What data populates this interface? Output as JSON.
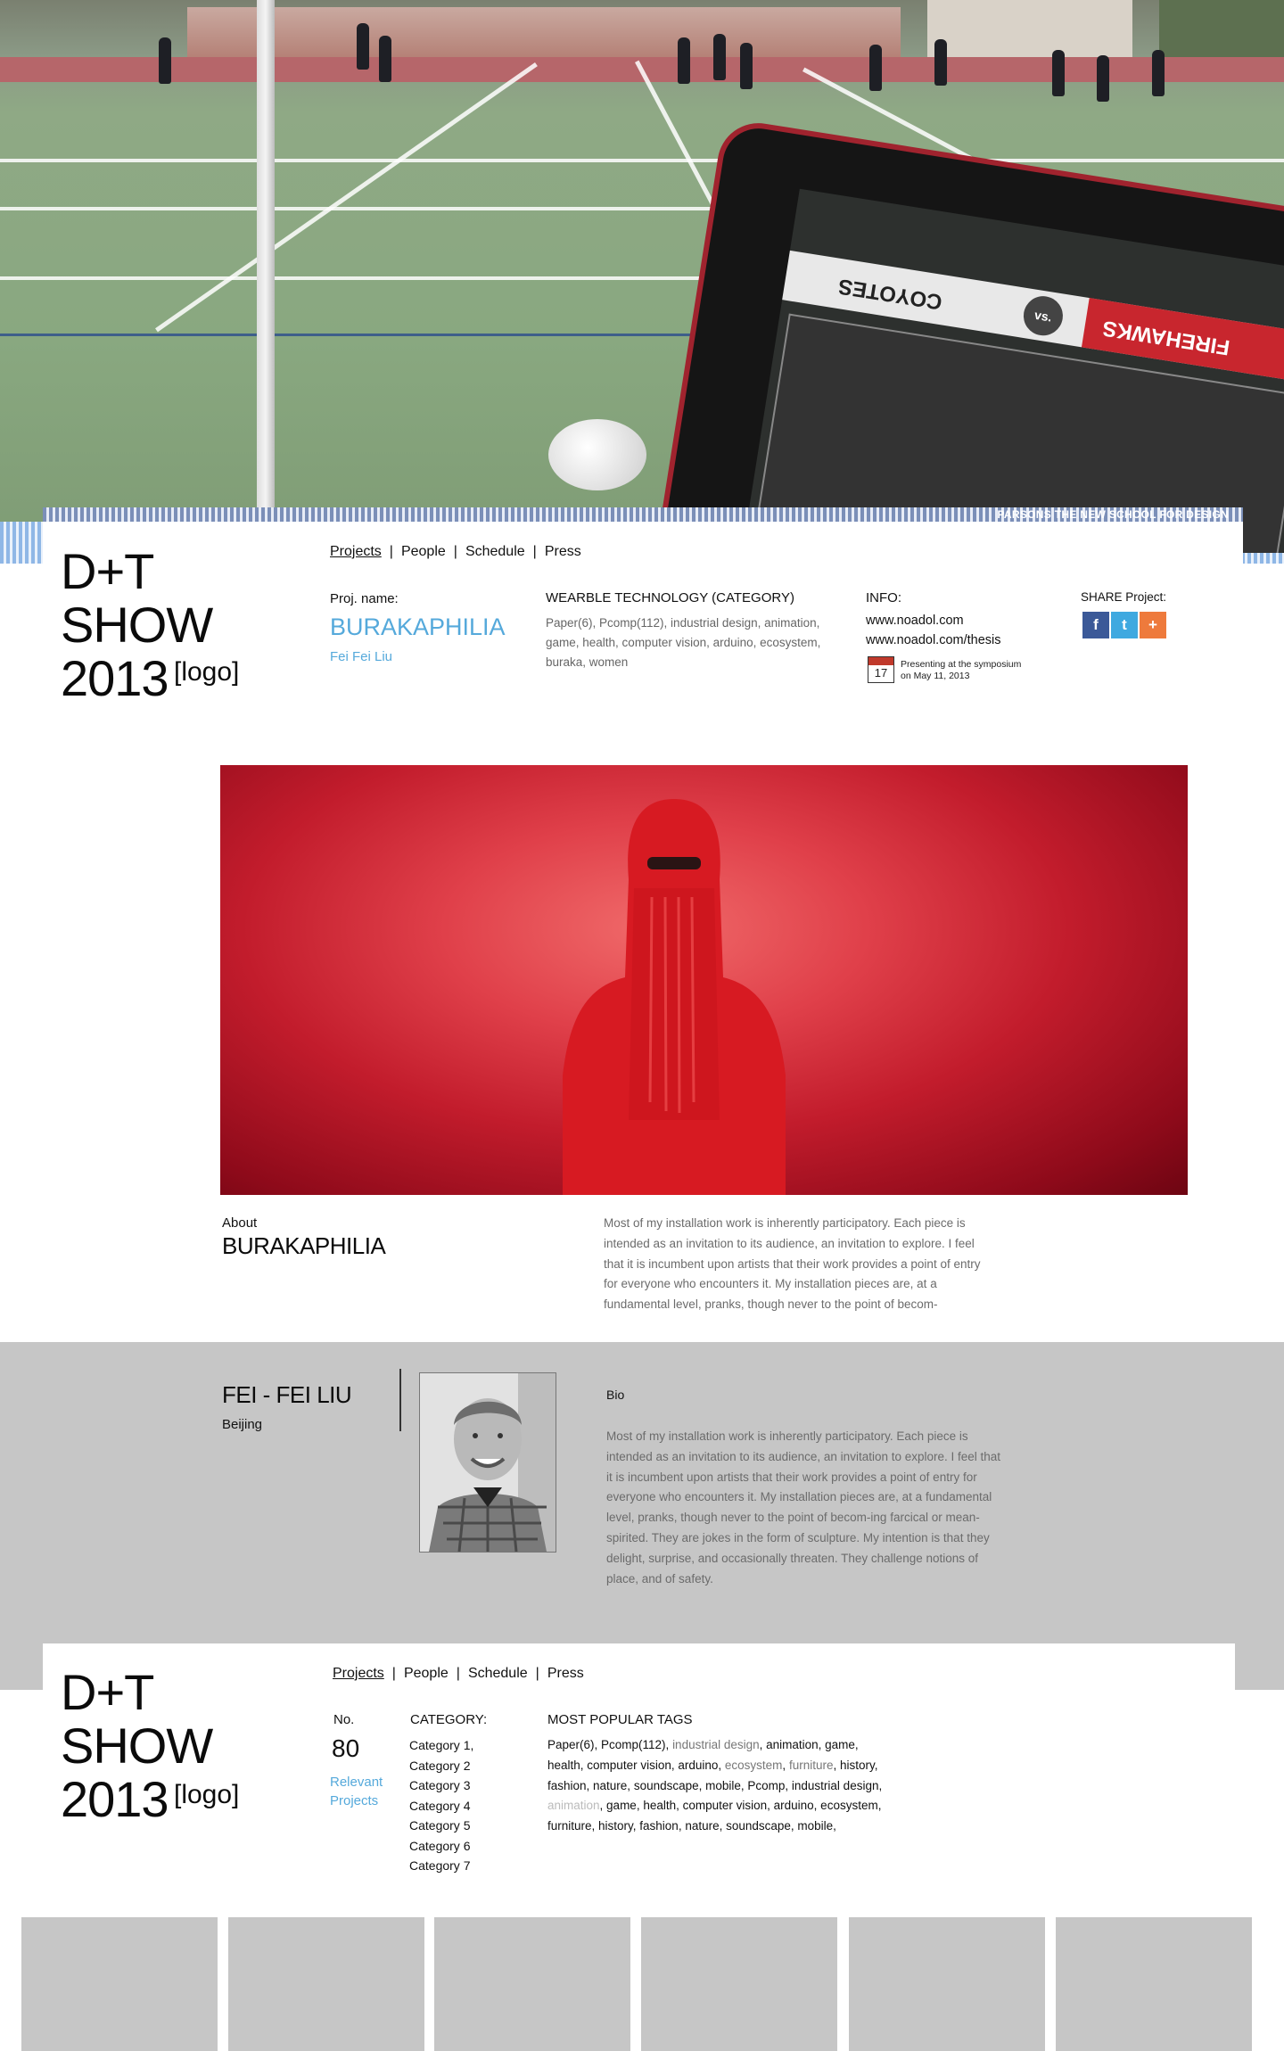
{
  "hero": {
    "banner_text": "PARSONS THE NEW SCHOOL FOR DESIGN",
    "tablet": {
      "team_left": "COYOTES",
      "vs": "vs.",
      "team_right": "FIREHAWKS"
    }
  },
  "header": {
    "logo_line1": "D+T",
    "logo_line2": "SHOW",
    "logo_line3": "2013",
    "logo_tag": "[logo]",
    "nav": [
      "Projects",
      "People",
      "Schedule",
      "Press"
    ],
    "nav_sep": "|",
    "proj_label": "Proj. name:",
    "proj_title": "BURAKAPHILIA",
    "proj_author": "Fei Fei Liu",
    "category_label": "WEARBLE TECHNOLOGY (CATEGORY)",
    "tags_text": "Paper(6), Pcomp(112), industrial design, animation, game, health, computer vision, arduino, ecosystem, buraka, women",
    "info_label": "INFO:",
    "info_url1": "www.noadol.com",
    "info_url2": "www.noadol.com/thesis",
    "calendar_day": "17",
    "present_line1": "Presenting at the symposium",
    "present_line2": "on May 11, 2013",
    "share_label": "SHARE Project:",
    "share_buttons": [
      {
        "name": "facebook",
        "glyph": "f",
        "color": "#3b5998"
      },
      {
        "name": "twitter",
        "glyph": "t",
        "color": "#3fa9e0"
      },
      {
        "name": "more",
        "glyph": "+",
        "color": "#ee7a3c"
      }
    ]
  },
  "about": {
    "label": "About",
    "title": "BURAKAPHILIA",
    "text": "Most of my installation work is inherently participatory. Each piece is intended as an invitation to its audience, an invitation to explore. I feel that it is incumbent upon artists that their work provides a point of entry for everyone who encounters it. My installation pieces are, at a fundamental level, pranks, though never to the point of becom-"
  },
  "bio": {
    "name": "FEI - FEI LIU",
    "city": "Beijing",
    "label": "Bio",
    "text": "Most of my installation work is inherently participatory. Each piece is intended as an invitation to its audience, an invitation to explore. I feel that it is incumbent upon artists that their work provides a point of entry for everyone who encounters it. My installation pieces are, at a fundamental level, pranks, though never to the point of becom-ing farcical or mean-spirited. They are jokes in the form of sculpture. My intention is that they delight, surprise, and occasionally threaten. They challenge notions of place, and of safety."
  },
  "footer_header": {
    "no_label": "No.",
    "count": "80",
    "relevant_line1": "Relevant",
    "relevant_line2": "Projects",
    "category_label": "CATEGORY:",
    "categories": [
      "Category 1,",
      "Category 2",
      "Category 3",
      "Category 4",
      "Category 5",
      "Category 6",
      "Category 7"
    ],
    "popular_label": "MOST POPULAR TAGS",
    "popular_tags": [
      {
        "t": "Paper(6), Pcomp(112), ",
        "s": ""
      },
      {
        "t": "industrial design",
        "s": "muted"
      },
      {
        "t": ", animation, game, health, ",
        "s": ""
      },
      {
        "t": "computer vision",
        "s": ""
      },
      {
        "t": ", arduino, ",
        "s": ""
      },
      {
        "t": "ecosystem",
        "s": "muted"
      },
      {
        "t": ", ",
        "s": ""
      },
      {
        "t": "furniture",
        "s": "muted"
      },
      {
        "t": ", history, fashion, nature, soundscape, mobile, Pcomp, industrial design, ",
        "s": ""
      },
      {
        "t": "animation",
        "s": "faint"
      },
      {
        "t": ", game, health, computer vision, arduino, ecosystem, furniture, history, fashion, nature, soundscape, mobile,",
        "s": ""
      }
    ]
  },
  "colors": {
    "accent": "#55a9db",
    "band": "#c6c6c6",
    "red": "#c21c2c"
  }
}
